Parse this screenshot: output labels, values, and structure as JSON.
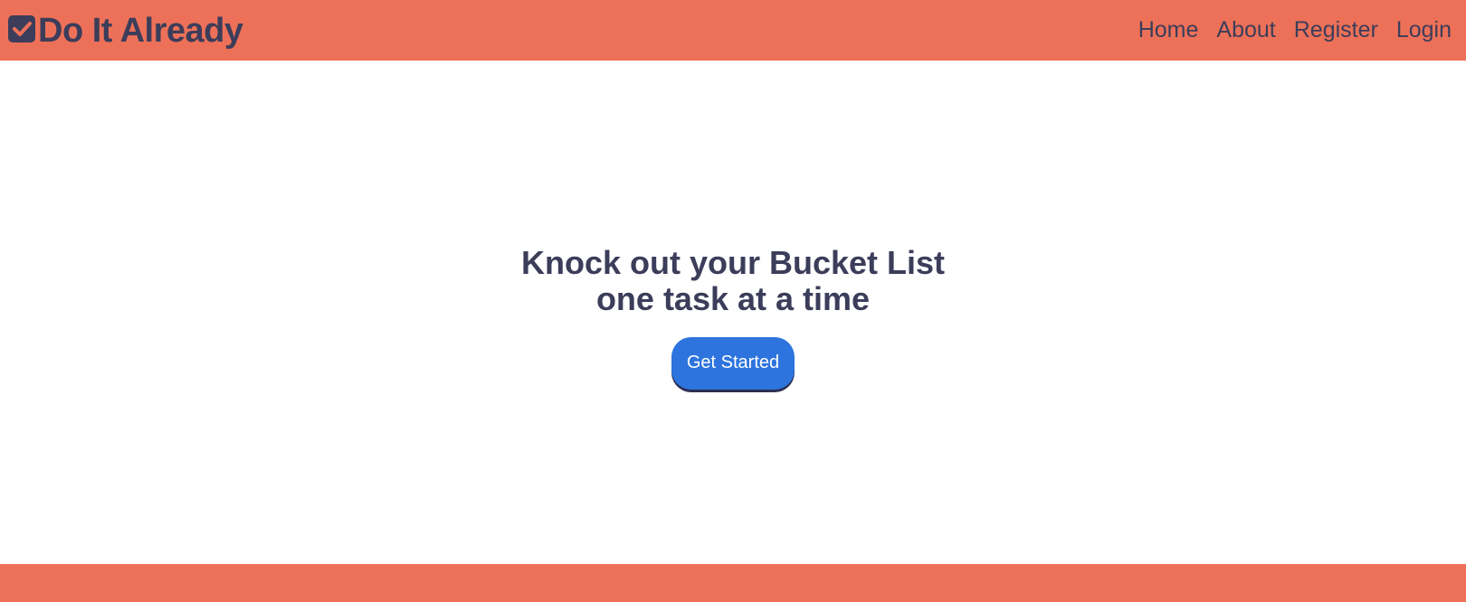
{
  "colors": {
    "bar": "#ed7158",
    "text": "#3c3d5a",
    "button": "#2d74de",
    "button_text": "#ffffff"
  },
  "header": {
    "brand": {
      "icon": "checkbox-checked-icon",
      "name": "Do It Already"
    },
    "nav": [
      {
        "label": "Home"
      },
      {
        "label": "About"
      },
      {
        "label": "Register"
      },
      {
        "label": "Login"
      }
    ]
  },
  "hero": {
    "title_line1": "Knock out your Bucket List",
    "title_line2": "one task at a time",
    "cta_label": "Get Started"
  }
}
